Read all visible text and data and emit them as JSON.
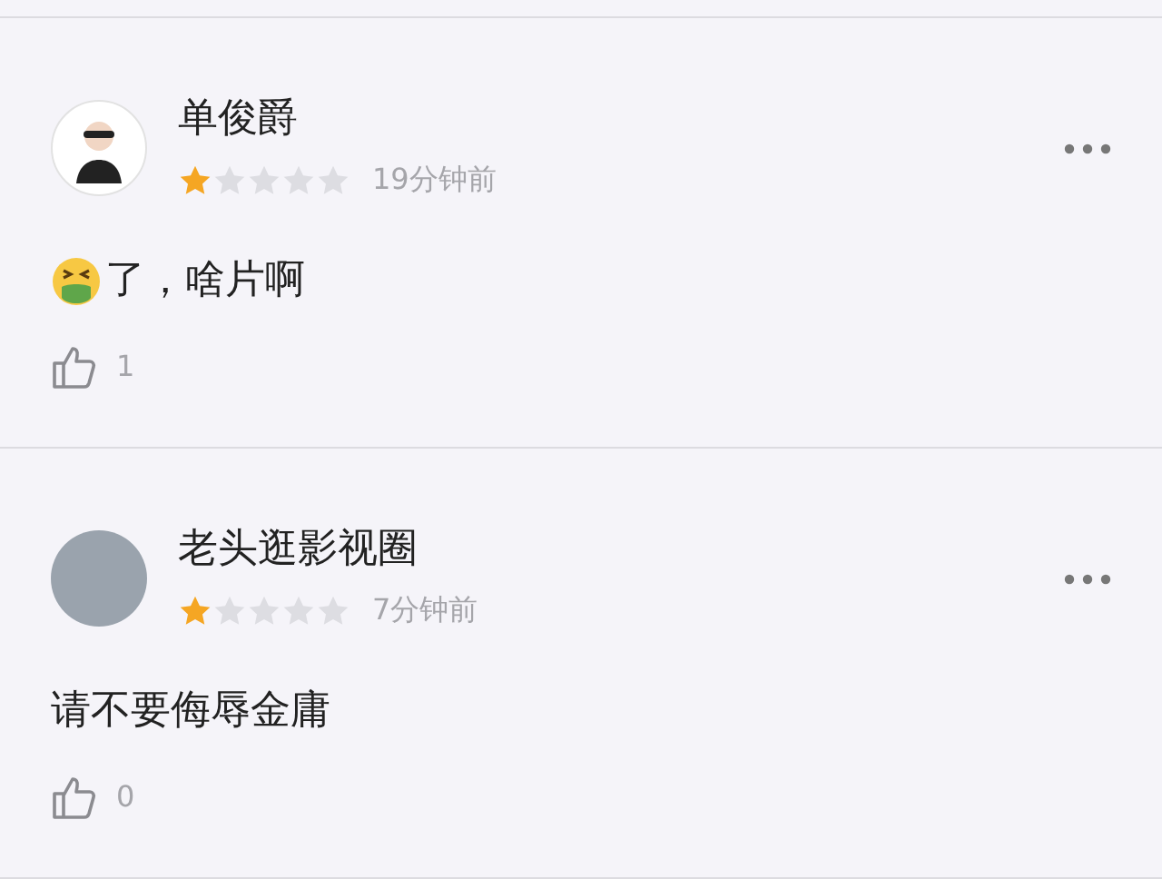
{
  "comments": [
    {
      "user": "单俊爵",
      "kind": "cartoon",
      "stars": 1,
      "time": "19分钟前",
      "text": "了，啥片啊",
      "emoji": true,
      "likes": "1"
    },
    {
      "user": "老头逛影视圈",
      "kind": "photo",
      "stars": 1,
      "time": "7分钟前",
      "text": "请不要侮辱金庸",
      "emoji": false,
      "likes": "0"
    }
  ]
}
